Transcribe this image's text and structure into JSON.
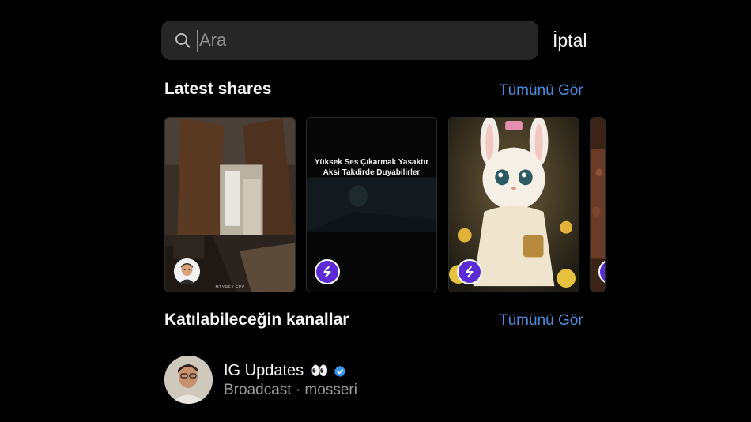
{
  "search": {
    "placeholder": "Ara",
    "value": "",
    "cancel_label": "İptal"
  },
  "latest_shares": {
    "title": "Latest shares",
    "see_all_label": "Tümünü Gör",
    "cards": [
      {
        "kind": "photo-room",
        "badge": "avatar-icon",
        "watermark": "MTYREK FPV"
      },
      {
        "kind": "video-dark",
        "badge": "threads-icon",
        "caption": "Yüksek Ses Çıkarmak Yasaktır\nAksi Takdirde Duyabilirler"
      },
      {
        "kind": "bunny-art",
        "badge": "threads-icon"
      },
      {
        "kind": "partial",
        "badge": "threads-icon"
      }
    ]
  },
  "channels": {
    "title": "Katılabileceğin kanallar",
    "see_all_label": "Tümünü Gör",
    "items": [
      {
        "name": "IG Updates",
        "emoji": "👀",
        "verified": true,
        "subtitle": "Broadcast · mosseri"
      }
    ]
  },
  "colors": {
    "background": "#000000",
    "search_bg": "#262626",
    "link": "#4a8ce0",
    "badge_purple": "#5b2bd6",
    "verified_blue": "#3897f0"
  }
}
